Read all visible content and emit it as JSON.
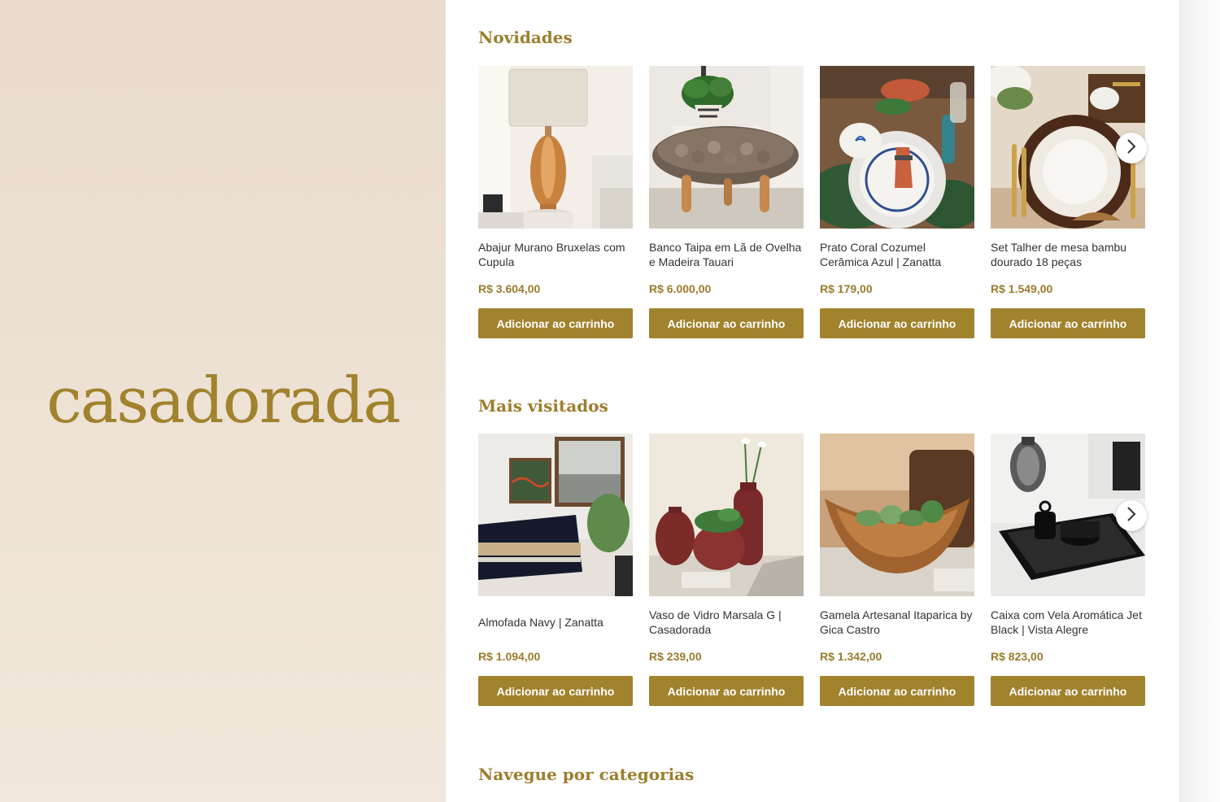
{
  "brand": {
    "name": "casadorada"
  },
  "colors": {
    "accent": "#a1822d",
    "price": "#9c7a2c",
    "panel": "#ecdfd0"
  },
  "sections": [
    {
      "title": "Novidades",
      "products": [
        {
          "name": "Abajur Murano Bruxelas com Cupula",
          "price": "R$ 3.604,00",
          "button": "Adicionar ao carrinho",
          "image": "amber-murano-lamp"
        },
        {
          "name": "Banco Taipa em Lã de Ovelha e Madeira Tauari",
          "price": "R$ 6.000,00",
          "button": "Adicionar ao carrinho",
          "image": "felt-ball-stool"
        },
        {
          "name": "Prato Coral Cozumel Cerâmica Azul | Zanatta",
          "price": "R$ 179,00",
          "button": "Adicionar ao carrinho",
          "image": "coral-table-setting"
        },
        {
          "name": "Set Talher de mesa bambu dourado 18 peças",
          "price": "R$ 1.549,00",
          "button": "Adicionar ao carrinho",
          "image": "bamboo-cutlery-setting"
        }
      ],
      "next_icon": "chevron-right-icon"
    },
    {
      "title": "Mais visitados",
      "products": [
        {
          "name": "Almofada Navy | Zanatta",
          "price": "R$ 1.094,00",
          "button": "Adicionar ao carrinho",
          "image": "navy-cushion-sofa"
        },
        {
          "name": "Vaso de Vidro Marsala G | Casadorada",
          "price": "R$ 239,00",
          "button": "Adicionar ao carrinho",
          "image": "marsala-glass-vases"
        },
        {
          "name": "Gamela Artesanal Itaparica by Gica Castro",
          "price": "R$ 1.342,00",
          "button": "Adicionar ao carrinho",
          "image": "wooden-bowl-succulents"
        },
        {
          "name": "Caixa com Vela Aromática Jet Black | Vista Alegre",
          "price": "R$ 823,00",
          "button": "Adicionar ao carrinho",
          "image": "black-candle-tray"
        }
      ],
      "next_icon": "chevron-right-icon"
    },
    {
      "title": "Navegue por categorias"
    }
  ]
}
